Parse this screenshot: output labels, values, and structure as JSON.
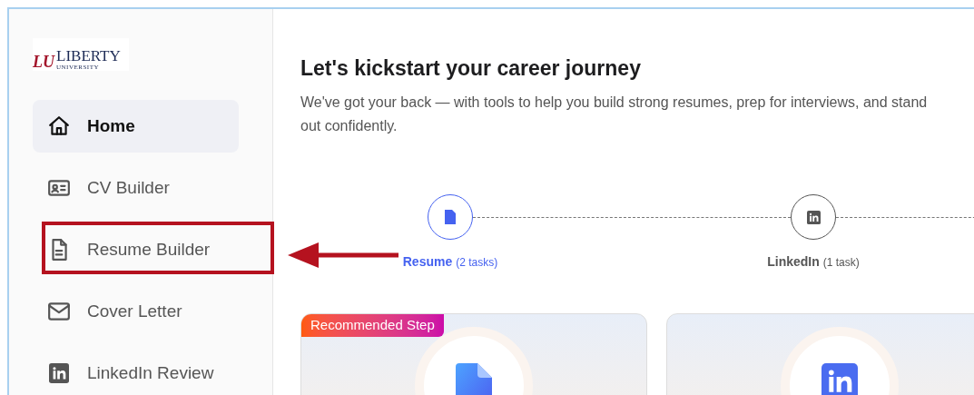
{
  "logo": {
    "mark": "LU",
    "name": "LIBERTY",
    "subtitle": "UNIVERSITY"
  },
  "sidebar": {
    "items": [
      {
        "kind": "home",
        "label": "Home",
        "selected": true,
        "highlighted": false
      },
      {
        "kind": "id-card",
        "label": "CV Builder",
        "selected": false,
        "highlighted": false
      },
      {
        "kind": "document",
        "label": "Resume Builder",
        "selected": false,
        "highlighted": true
      },
      {
        "kind": "mail",
        "label": "Cover Letter",
        "selected": false,
        "highlighted": false
      },
      {
        "kind": "linkedin",
        "label": "LinkedIn Review",
        "selected": false,
        "highlighted": false
      }
    ]
  },
  "heading": "Let's kickstart your career journey",
  "subheading": "We've got your back — with tools to help you build strong resumes, prep for interviews, and stand out confidently.",
  "steps": [
    {
      "kind": "document",
      "label": "Resume",
      "count": "(2 tasks)",
      "selected": true
    },
    {
      "kind": "linkedin",
      "label": "LinkedIn",
      "count": "(1 task)",
      "selected": false
    }
  ],
  "cards": [
    {
      "kind": "document",
      "badge": "Recommended Step"
    },
    {
      "kind": "linkedin"
    }
  ]
}
